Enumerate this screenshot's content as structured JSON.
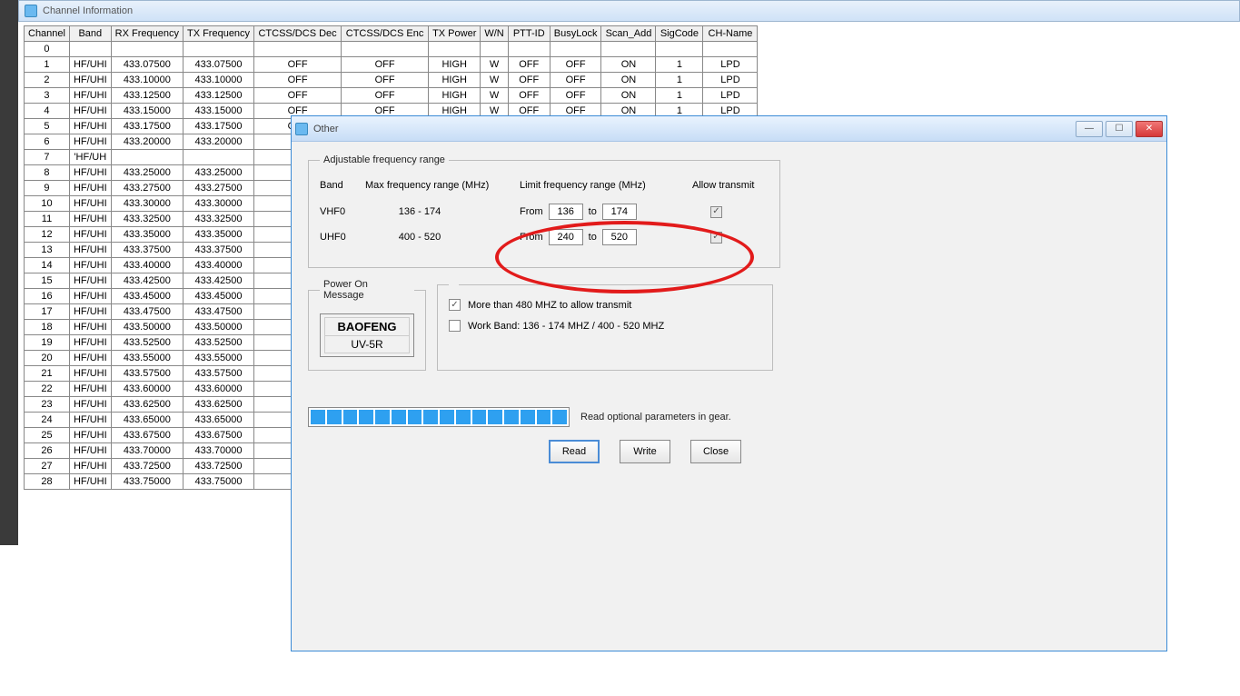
{
  "channelWindow": {
    "title": "Channel Information",
    "headers": {
      "channel": "Channel",
      "band": "Band",
      "rx": "RX Frequency",
      "tx": "TX Frequency",
      "ctdec": "CTCSS/DCS Dec",
      "ctenc": "CTCSS/DCS Enc",
      "txpow": "TX Power",
      "wn": "W/N",
      "ptt": "PTT-ID",
      "busy": "BusyLock",
      "scan": "Scan_Add",
      "sig": "SigCode",
      "chname": "CH-Name"
    },
    "rows": [
      {
        "ch": "0",
        "band": "",
        "rx": "",
        "tx": "",
        "ctdec": "",
        "ctenc": "",
        "txpow": "",
        "wn": "",
        "ptt": "",
        "busy": "",
        "scan": "",
        "sig": "",
        "name": ""
      },
      {
        "ch": "1",
        "band": "HF/UHI",
        "rx": "433.07500",
        "tx": "433.07500",
        "ctdec": "OFF",
        "ctenc": "OFF",
        "txpow": "HIGH",
        "wn": "W",
        "ptt": "OFF",
        "busy": "OFF",
        "scan": "ON",
        "sig": "1",
        "name": "LPD"
      },
      {
        "ch": "2",
        "band": "HF/UHI",
        "rx": "433.10000",
        "tx": "433.10000",
        "ctdec": "OFF",
        "ctenc": "OFF",
        "txpow": "HIGH",
        "wn": "W",
        "ptt": "OFF",
        "busy": "OFF",
        "scan": "ON",
        "sig": "1",
        "name": "LPD"
      },
      {
        "ch": "3",
        "band": "HF/UHI",
        "rx": "433.12500",
        "tx": "433.12500",
        "ctdec": "OFF",
        "ctenc": "OFF",
        "txpow": "HIGH",
        "wn": "W",
        "ptt": "OFF",
        "busy": "OFF",
        "scan": "ON",
        "sig": "1",
        "name": "LPD"
      },
      {
        "ch": "4",
        "band": "HF/UHI",
        "rx": "433.15000",
        "tx": "433.15000",
        "ctdec": "OFF",
        "ctenc": "OFF",
        "txpow": "HIGH",
        "wn": "W",
        "ptt": "OFF",
        "busy": "OFF",
        "scan": "ON",
        "sig": "1",
        "name": "LPD"
      },
      {
        "ch": "5",
        "band": "HF/UHI",
        "rx": "433.17500",
        "tx": "433.17500",
        "ctdec": "OFF"
      },
      {
        "ch": "6",
        "band": "HF/UHI",
        "rx": "433.20000",
        "tx": "433.20000",
        "ctdec": "OF"
      },
      {
        "ch": "7",
        "band": "'HF/UH",
        "rx": "",
        "tx": "",
        "ctdec": ""
      },
      {
        "ch": "8",
        "band": "HF/UHI",
        "rx": "433.25000",
        "tx": "433.25000",
        "ctdec": "OF"
      },
      {
        "ch": "9",
        "band": "HF/UHI",
        "rx": "433.27500",
        "tx": "433.27500",
        "ctdec": "OF"
      },
      {
        "ch": "10",
        "band": "HF/UHI",
        "rx": "433.30000",
        "tx": "433.30000",
        "ctdec": "OF"
      },
      {
        "ch": "11",
        "band": "HF/UHI",
        "rx": "433.32500",
        "tx": "433.32500",
        "ctdec": "OF"
      },
      {
        "ch": "12",
        "band": "HF/UHI",
        "rx": "433.35000",
        "tx": "433.35000",
        "ctdec": "OF"
      },
      {
        "ch": "13",
        "band": "HF/UHI",
        "rx": "433.37500",
        "tx": "433.37500",
        "ctdec": "OF"
      },
      {
        "ch": "14",
        "band": "HF/UHI",
        "rx": "433.40000",
        "tx": "433.40000",
        "ctdec": "OF"
      },
      {
        "ch": "15",
        "band": "HF/UHI",
        "rx": "433.42500",
        "tx": "433.42500",
        "ctdec": "OF"
      },
      {
        "ch": "16",
        "band": "HF/UHI",
        "rx": "433.45000",
        "tx": "433.45000",
        "ctdec": "OF"
      },
      {
        "ch": "17",
        "band": "HF/UHI",
        "rx": "433.47500",
        "tx": "433.47500",
        "ctdec": "OF"
      },
      {
        "ch": "18",
        "band": "HF/UHI",
        "rx": "433.50000",
        "tx": "433.50000",
        "ctdec": "OF"
      },
      {
        "ch": "19",
        "band": "HF/UHI",
        "rx": "433.52500",
        "tx": "433.52500",
        "ctdec": "OF"
      },
      {
        "ch": "20",
        "band": "HF/UHI",
        "rx": "433.55000",
        "tx": "433.55000",
        "ctdec": "OF"
      },
      {
        "ch": "21",
        "band": "HF/UHI",
        "rx": "433.57500",
        "tx": "433.57500",
        "ctdec": "OF"
      },
      {
        "ch": "22",
        "band": "HF/UHI",
        "rx": "433.60000",
        "tx": "433.60000",
        "ctdec": "OF"
      },
      {
        "ch": "23",
        "band": "HF/UHI",
        "rx": "433.62500",
        "tx": "433.62500",
        "ctdec": "OF"
      },
      {
        "ch": "24",
        "band": "HF/UHI",
        "rx": "433.65000",
        "tx": "433.65000",
        "ctdec": "OF"
      },
      {
        "ch": "25",
        "band": "HF/UHI",
        "rx": "433.67500",
        "tx": "433.67500",
        "ctdec": "OF"
      },
      {
        "ch": "26",
        "band": "HF/UHI",
        "rx": "433.70000",
        "tx": "433.70000",
        "ctdec": "OF"
      },
      {
        "ch": "27",
        "band": "HF/UHI",
        "rx": "433.72500",
        "tx": "433.72500",
        "ctdec": "OF"
      },
      {
        "ch": "28",
        "band": "HF/UHI",
        "rx": "433.75000",
        "tx": "433.75000",
        "ctdec": "OF"
      }
    ]
  },
  "otherDialog": {
    "title": "Other",
    "freqRange": {
      "legend": "Adjustable  frequency  range",
      "headers": {
        "band": "Band",
        "max": "Max frequency range (MHz)",
        "limit": "Limit frequency range (MHz)",
        "allow": "Allow transmit"
      },
      "fromLabel": "From",
      "toLabel": "to",
      "vhf": {
        "name": "VHF0",
        "max": "136 - 174",
        "from": "136",
        "to": "174",
        "allow": true
      },
      "uhf": {
        "name": "UHF0",
        "max": "400 - 520",
        "from": "240",
        "to": "520",
        "allow": true
      }
    },
    "powerOn": {
      "legend": "Power On Message",
      "line1": "BAOFENG",
      "line2": "UV-5R"
    },
    "options": {
      "moreThan480": {
        "checked": true,
        "label": "More than 480 MHZ to allow transmit"
      },
      "workBand": {
        "checked": false,
        "label": "Work Band: 136 - 174 MHZ / 400 - 520 MHZ"
      }
    },
    "progress": {
      "segments": 16,
      "label": "Read optional parameters in gear."
    },
    "buttons": {
      "read": "Read",
      "write": "Write",
      "close": "Close"
    }
  }
}
